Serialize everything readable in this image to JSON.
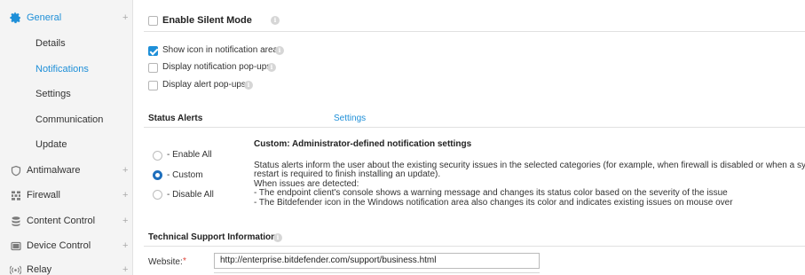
{
  "sidebar": {
    "items": [
      {
        "label": "General",
        "icon": "gear-icon",
        "plus": "+"
      },
      {
        "label": "Details"
      },
      {
        "label": "Notifications"
      },
      {
        "label": "Settings"
      },
      {
        "label": "Communication"
      },
      {
        "label": "Update"
      },
      {
        "label": "Antimalware",
        "icon": "shield-icon",
        "plus": "+"
      },
      {
        "label": "Firewall",
        "icon": "firewall-icon",
        "plus": "+"
      },
      {
        "label": "Content Control",
        "icon": "content-control-icon",
        "plus": "+"
      },
      {
        "label": "Device Control",
        "icon": "device-control-icon",
        "plus": "+"
      },
      {
        "label": "Relay",
        "icon": "relay-icon",
        "plus": "+"
      }
    ],
    "active": "Notifications"
  },
  "silent_mode": {
    "label": "Enable Silent Mode",
    "checked": false
  },
  "options": [
    {
      "label": "Show icon in notification area",
      "checked": true
    },
    {
      "label": "Display notification pop-ups",
      "checked": false
    },
    {
      "label": "Display alert pop-ups",
      "checked": false
    }
  ],
  "status_alerts": {
    "title": "Status Alerts",
    "settings_link": "Settings",
    "radios": [
      {
        "label": "- Enable All",
        "selected": false
      },
      {
        "label": "- Custom",
        "selected": true
      },
      {
        "label": "- Disable All",
        "selected": false
      }
    ],
    "desc_title": "Custom: Administrator-defined notification settings",
    "desc_lines": [
      "Status alerts inform the user about the existing security issues in the selected categories (for example, when firewall is disabled or when a system",
      "restart is required to finish installing an update).",
      "When issues are detected:",
      "- The endpoint client's console shows a warning message and changes its status color based on the severity of the issue",
      "- The Bitdefender icon in the Windows notification area also changes its color and indicates existing issues on mouse over"
    ]
  },
  "tech_support": {
    "title": "Technical Support Information",
    "website_label": "Website:",
    "required_mark": "*",
    "website_value": "http://enterprise.bitdefender.com/support/business.html"
  },
  "colors": {
    "accent": "#1e8fd8",
    "sidebar_bg": "#f4f4f4"
  }
}
